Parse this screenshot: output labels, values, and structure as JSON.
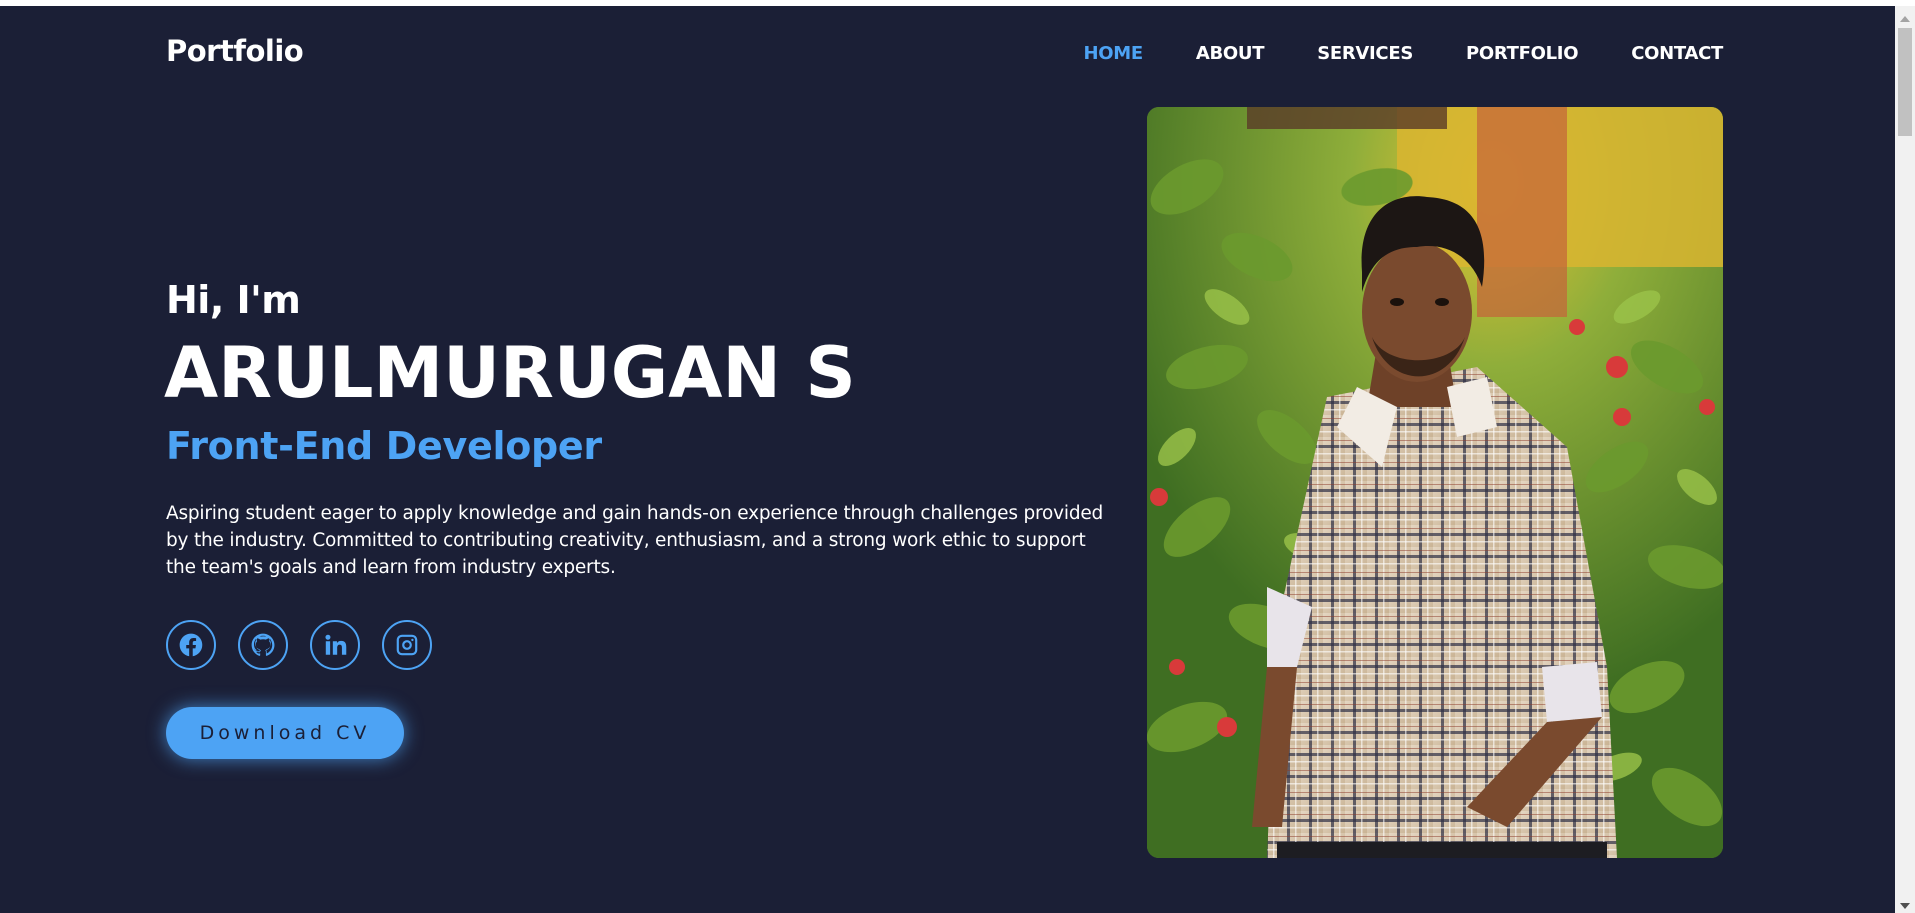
{
  "nav": {
    "brand": "Portfolio",
    "links": [
      {
        "label": "HOME",
        "active": true
      },
      {
        "label": "ABOUT",
        "active": false
      },
      {
        "label": "SERVICES",
        "active": false
      },
      {
        "label": "PORTFOLIO",
        "active": false
      },
      {
        "label": "CONTACT",
        "active": false
      }
    ]
  },
  "hero": {
    "greeting": "Hi, I'm",
    "name": "ARULMURUGAN S",
    "role": "Front-End Developer",
    "description": "Aspiring student eager to apply knowledge and gain hands-on experience through challenges provided by the industry. Committed to contributing creativity, enthusiasm, and a strong work ethic to support the team's goals and learn from industry experts.",
    "socials": [
      "facebook-icon",
      "github-icon",
      "linkedin-icon",
      "instagram-icon"
    ],
    "cv_button": "Download CV"
  },
  "colors": {
    "background": "#1b1f36",
    "accent": "#4da3f4",
    "text": "#ffffff"
  }
}
